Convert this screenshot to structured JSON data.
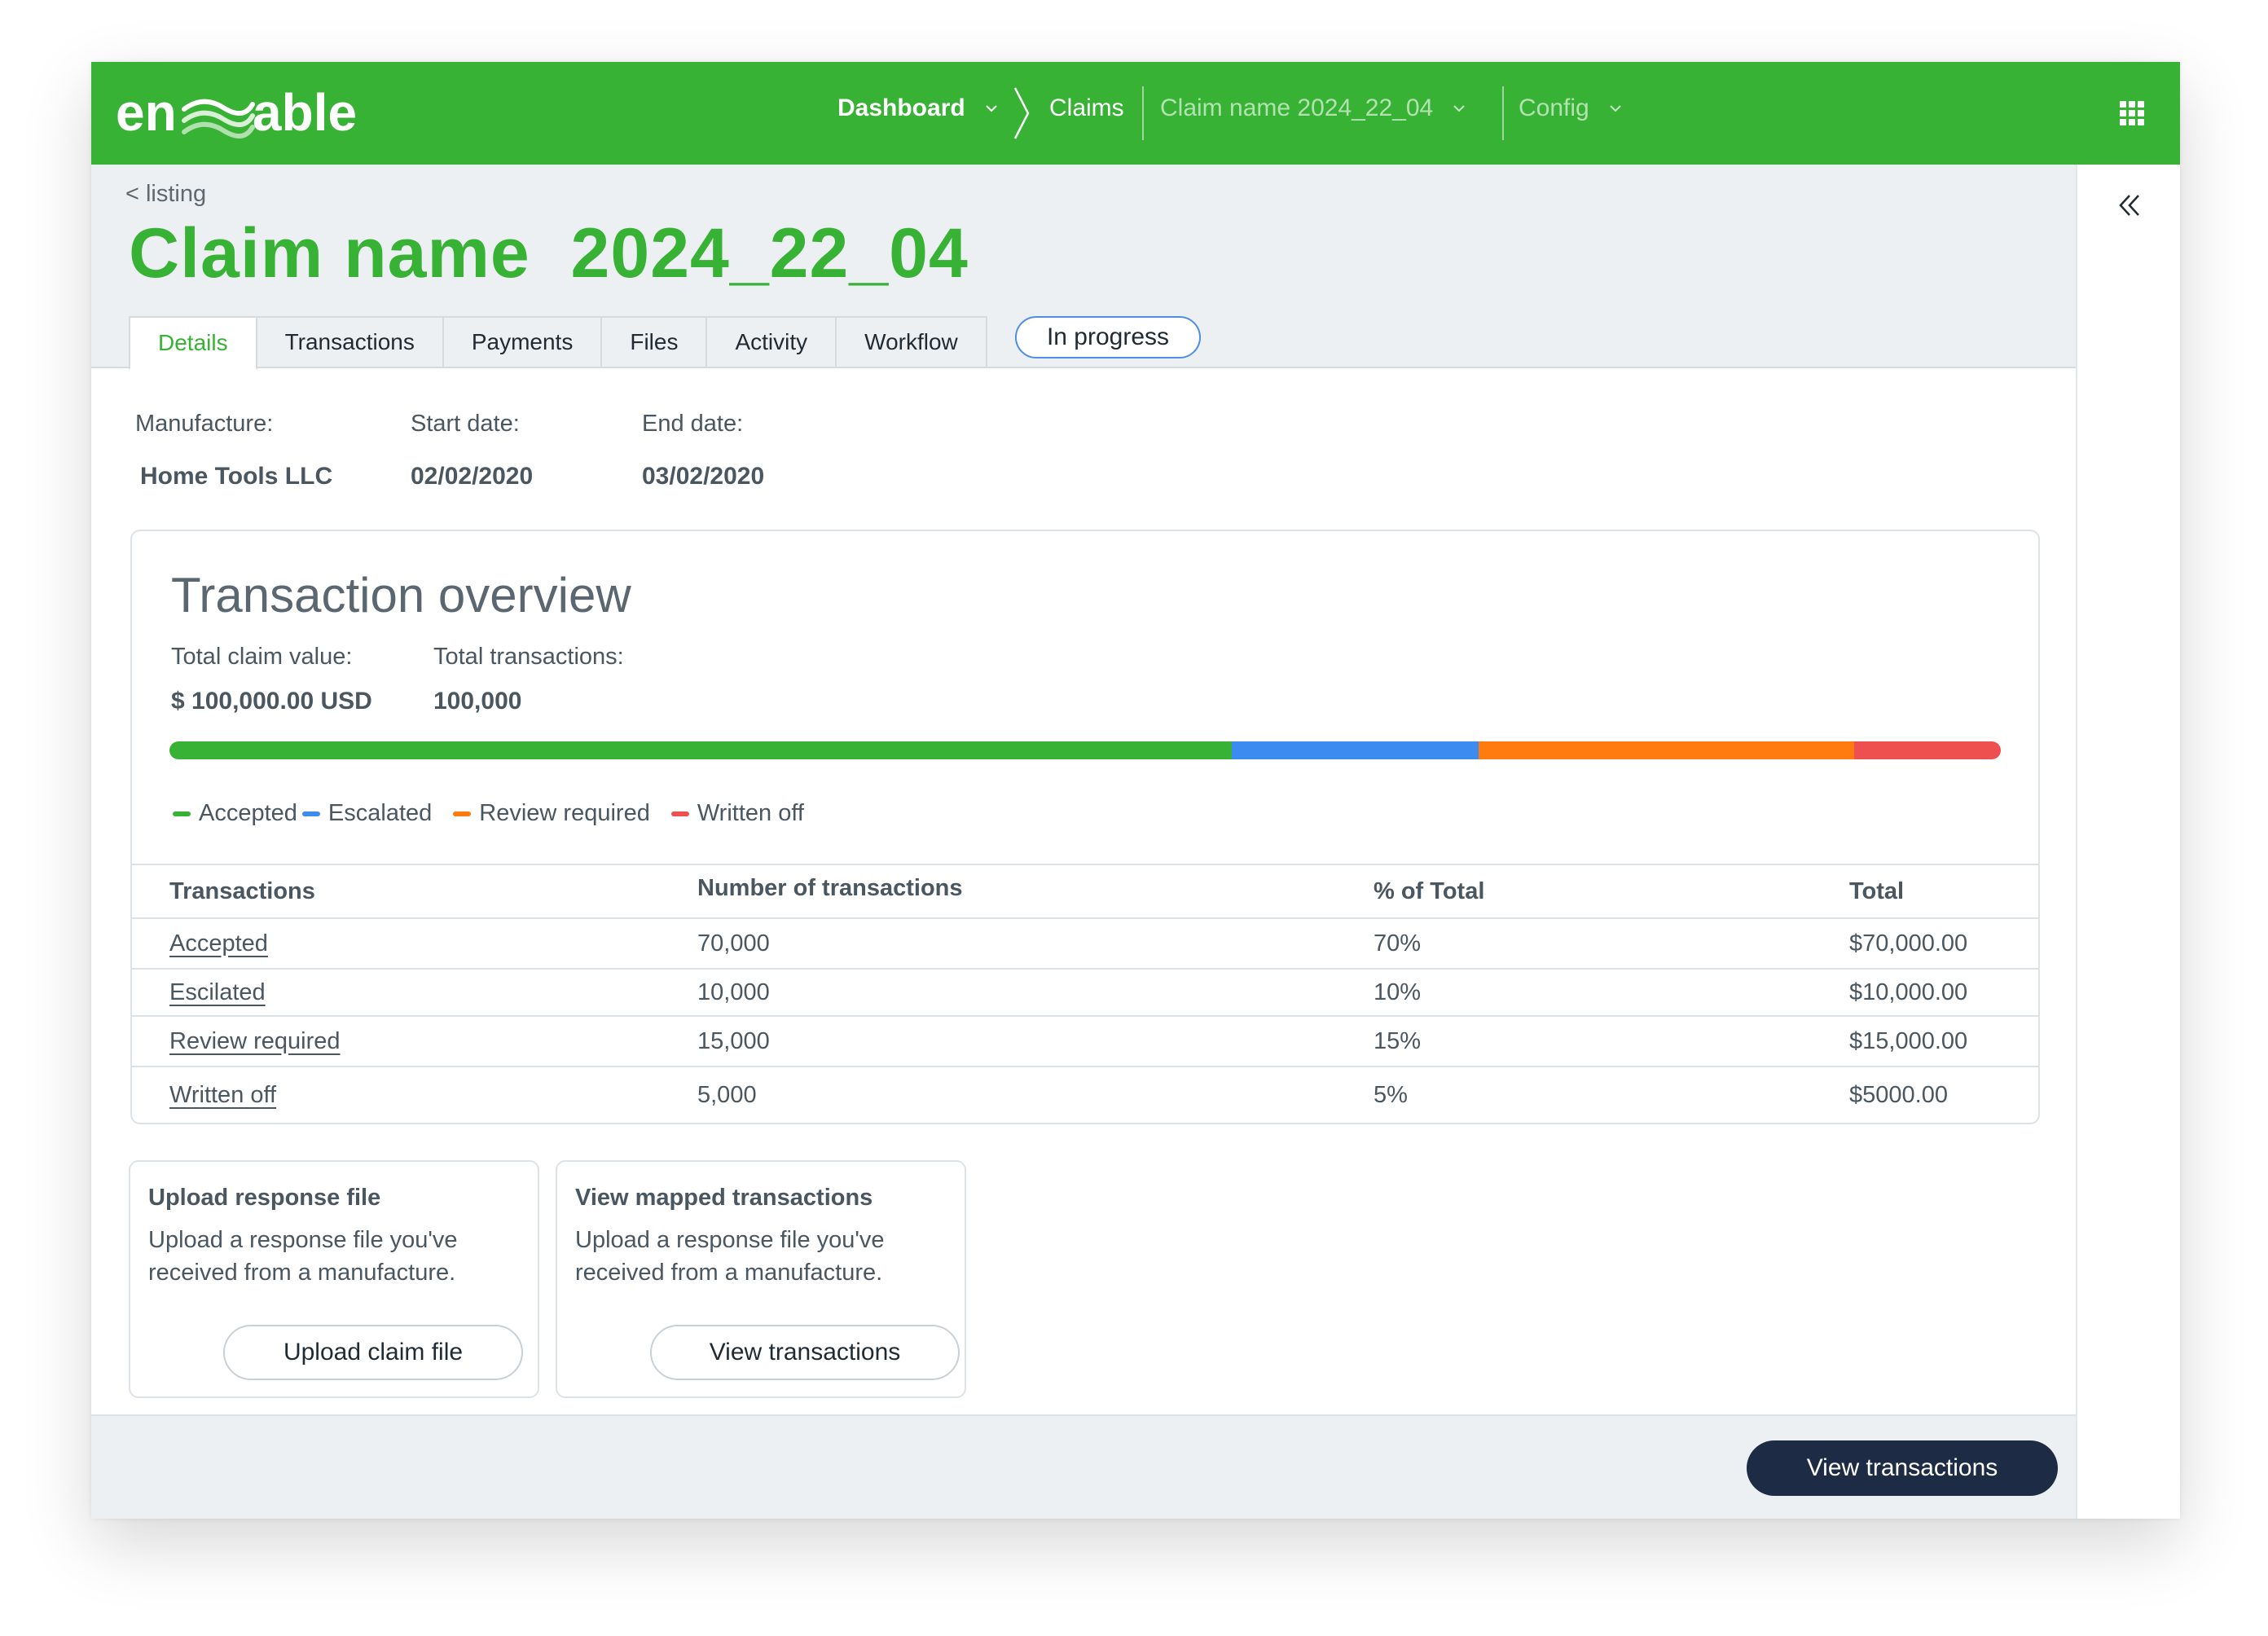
{
  "app": {
    "logo_text": "enable"
  },
  "nav": {
    "dashboard": "Dashboard",
    "claims": "Claims",
    "claim_name": "Claim name 2024_22_04",
    "config": "Config"
  },
  "header": {
    "back_link": "< listing",
    "title": "Claim name  2024_22_04",
    "status": "In progress"
  },
  "tabs": [
    "Details",
    "Transactions",
    "Payments",
    "Files",
    "Activity",
    "Workflow"
  ],
  "active_tab": "Details",
  "details": {
    "manufacture_label": "Manufacture:",
    "manufacture_value": "Home Tools LLC",
    "start_label": "Start date:",
    "start_value": "02/02/2020",
    "end_label": "End date:",
    "end_value": "03/02/2020"
  },
  "overview": {
    "title": "Transaction overview",
    "total_value_label": "Total claim value:",
    "total_value": "$ 100,000.00 USD",
    "total_tx_label": "Total transactions:",
    "total_tx": "100,000",
    "segments": [
      {
        "label": "Accepted",
        "percent": 58,
        "color": "#37b234"
      },
      {
        "label": "Escalated",
        "percent": 13.5,
        "color": "#3b8bf0"
      },
      {
        "label": "Review required",
        "percent": 20.5,
        "color": "#ff7a0f"
      },
      {
        "label": "Written off",
        "percent": 8,
        "color": "#ee4f4f"
      }
    ]
  },
  "table": {
    "headers": [
      "Transactions",
      "Number of transactions",
      "% of Total",
      "Total"
    ],
    "rows": [
      [
        "Accepted",
        "70,000",
        "70%",
        "$70,000.00"
      ],
      [
        "Escilated",
        "10,000",
        "10%",
        "$10,000.00"
      ],
      [
        "Review required",
        "15,000",
        "15%",
        "$15,000.00"
      ],
      [
        "Written off",
        "5,000",
        "5%",
        "$5000.00"
      ]
    ]
  },
  "actions": {
    "upload": {
      "title": "Upload response file",
      "desc": "Upload a response file you've received from a manufacture.",
      "button": "Upload claim file"
    },
    "mapped": {
      "title": "View mapped transactions",
      "desc": "Upload a response file you've received from a manufacture.",
      "button": "View transactions"
    }
  },
  "footer": {
    "primary_button": "View transactions"
  },
  "colors": {
    "brand": "#37b234",
    "navy": "#1e2b45"
  }
}
